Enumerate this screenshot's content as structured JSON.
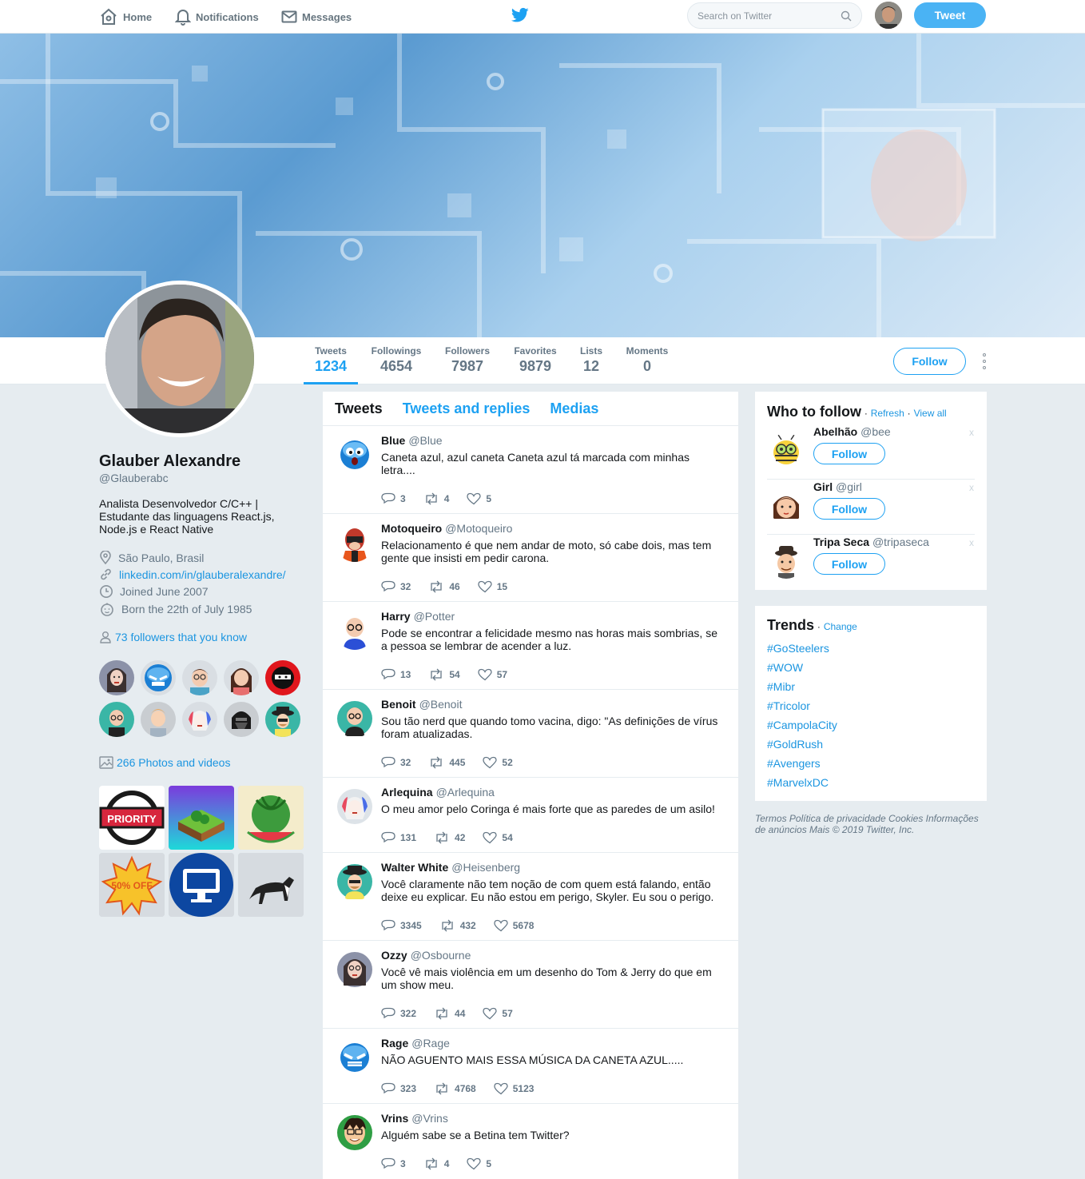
{
  "topbar": {
    "home_label": "Home",
    "notifications_label": "Notifications",
    "messages_label": "Messages",
    "search_placeholder": "Search on Twitter",
    "tweet_button": "Tweet"
  },
  "stats": [
    {
      "label": "Tweets",
      "value": "1234"
    },
    {
      "label": "Followings",
      "value": "4654"
    },
    {
      "label": "Followers",
      "value": "7987"
    },
    {
      "label": "Favorites",
      "value": "9879"
    },
    {
      "label": "Lists",
      "value": "12"
    },
    {
      "label": "Moments",
      "value": "0"
    }
  ],
  "follow_button": "Follow",
  "profile": {
    "name": "Glauber Alexandre",
    "handle": "@Glauberabc",
    "bio": "Analista Desenvolvedor C/C++ | Estudante das linguagens React.js, Node.js e React Native",
    "location": "São Paulo, Brasil",
    "link": "linkedin.com/in/glauberalexandre/",
    "joined": "Joined June 2007",
    "born": "Born the 22th of July 1985",
    "followers_you_know": "73 followers that you know",
    "photos_videos": "266 Photos and videos"
  },
  "photo_labels": {
    "priority": "PRIORITY",
    "discount": "50% OFF"
  },
  "timeline": {
    "tabs": [
      "Tweets",
      "Tweets and replies",
      "Medias"
    ],
    "tweets": [
      {
        "name": "Blue",
        "handle": "@Blue",
        "text": "Caneta azul, azul caneta Caneta azul tá marcada com minhas letra....",
        "replies": "3",
        "retweets": "4",
        "likes": "5"
      },
      {
        "name": "Motoqueiro",
        "handle": "@Motoqueiro",
        "text": "Relacionamento é que nem andar de moto, só cabe dois, mas tem gente que insisti em pedir carona.",
        "replies": "32",
        "retweets": "46",
        "likes": "15"
      },
      {
        "name": "Harry",
        "handle": "@Potter",
        "text": "Pode se encontrar a felicidade mesmo nas horas mais sombrias, se a pessoa se lembrar de acender a luz.",
        "replies": "13",
        "retweets": "54",
        "likes": "57"
      },
      {
        "name": "Benoit",
        "handle": "@Benoit",
        "text": "Sou tão nerd que quando tomo vacina, digo: \"As definições de vírus foram atualizadas.",
        "replies": "32",
        "retweets": "445",
        "likes": "52"
      },
      {
        "name": "Arlequina",
        "handle": "@Arlequina",
        "text": "O meu amor pelo Coringa é mais forte que as paredes de um asilo!",
        "replies": "131",
        "retweets": "42",
        "likes": "54"
      },
      {
        "name": "Walter White",
        "handle": "@Heisenberg",
        "text": "Você claramente não tem noção de com quem está falando, então deixe eu explicar. Eu não estou em perigo, Skyler. Eu sou o perigo.",
        "replies": "3345",
        "retweets": "432",
        "likes": "5678"
      },
      {
        "name": "Ozzy",
        "handle": "@Osbourne",
        "text": "Você vê mais violência em um desenho do Tom & Jerry do que em um show meu.",
        "replies": "322",
        "retweets": "44",
        "likes": "57"
      },
      {
        "name": "Rage",
        "handle": "@Rage",
        "text": "NÃO AGUENTO MAIS ESSA MÚSICA DA CANETA AZUL.....",
        "replies": "323",
        "retweets": "4768",
        "likes": "5123"
      },
      {
        "name": "Vrins",
        "handle": "@Vrins",
        "text": "Alguém sabe se a Betina tem Twitter?",
        "replies": "3",
        "retweets": "4",
        "likes": "5"
      }
    ]
  },
  "who_to_follow": {
    "title": "Who to follow",
    "sep1": "·",
    "refresh": "Refresh",
    "sep2": "·",
    "view_all": "View all",
    "users": [
      {
        "name": "Abelhão",
        "handle": "@bee",
        "button": "Follow",
        "close": "x"
      },
      {
        "name": "Girl",
        "handle": "@girl",
        "button": "Follow",
        "close": "x"
      },
      {
        "name": "Tripa Seca",
        "handle": "@tripaseca",
        "button": "Follow",
        "close": "x"
      }
    ]
  },
  "trends": {
    "title": "Trends",
    "sep": "·",
    "change": "Change",
    "items": [
      "#GoSteelers",
      "#WOW",
      "#Mibr",
      "#Tricolor",
      "#CampolaCity",
      "#GoldRush",
      "#Avengers",
      "#MarvelxDC"
    ]
  },
  "footer": "Termos Política de privacidade Cookies Informações de anúncios Mais © 2019 Twitter, Inc.",
  "colors": {
    "accent": "#1da1f2",
    "link": "#1b95e0",
    "background": "#e6ecf0"
  }
}
